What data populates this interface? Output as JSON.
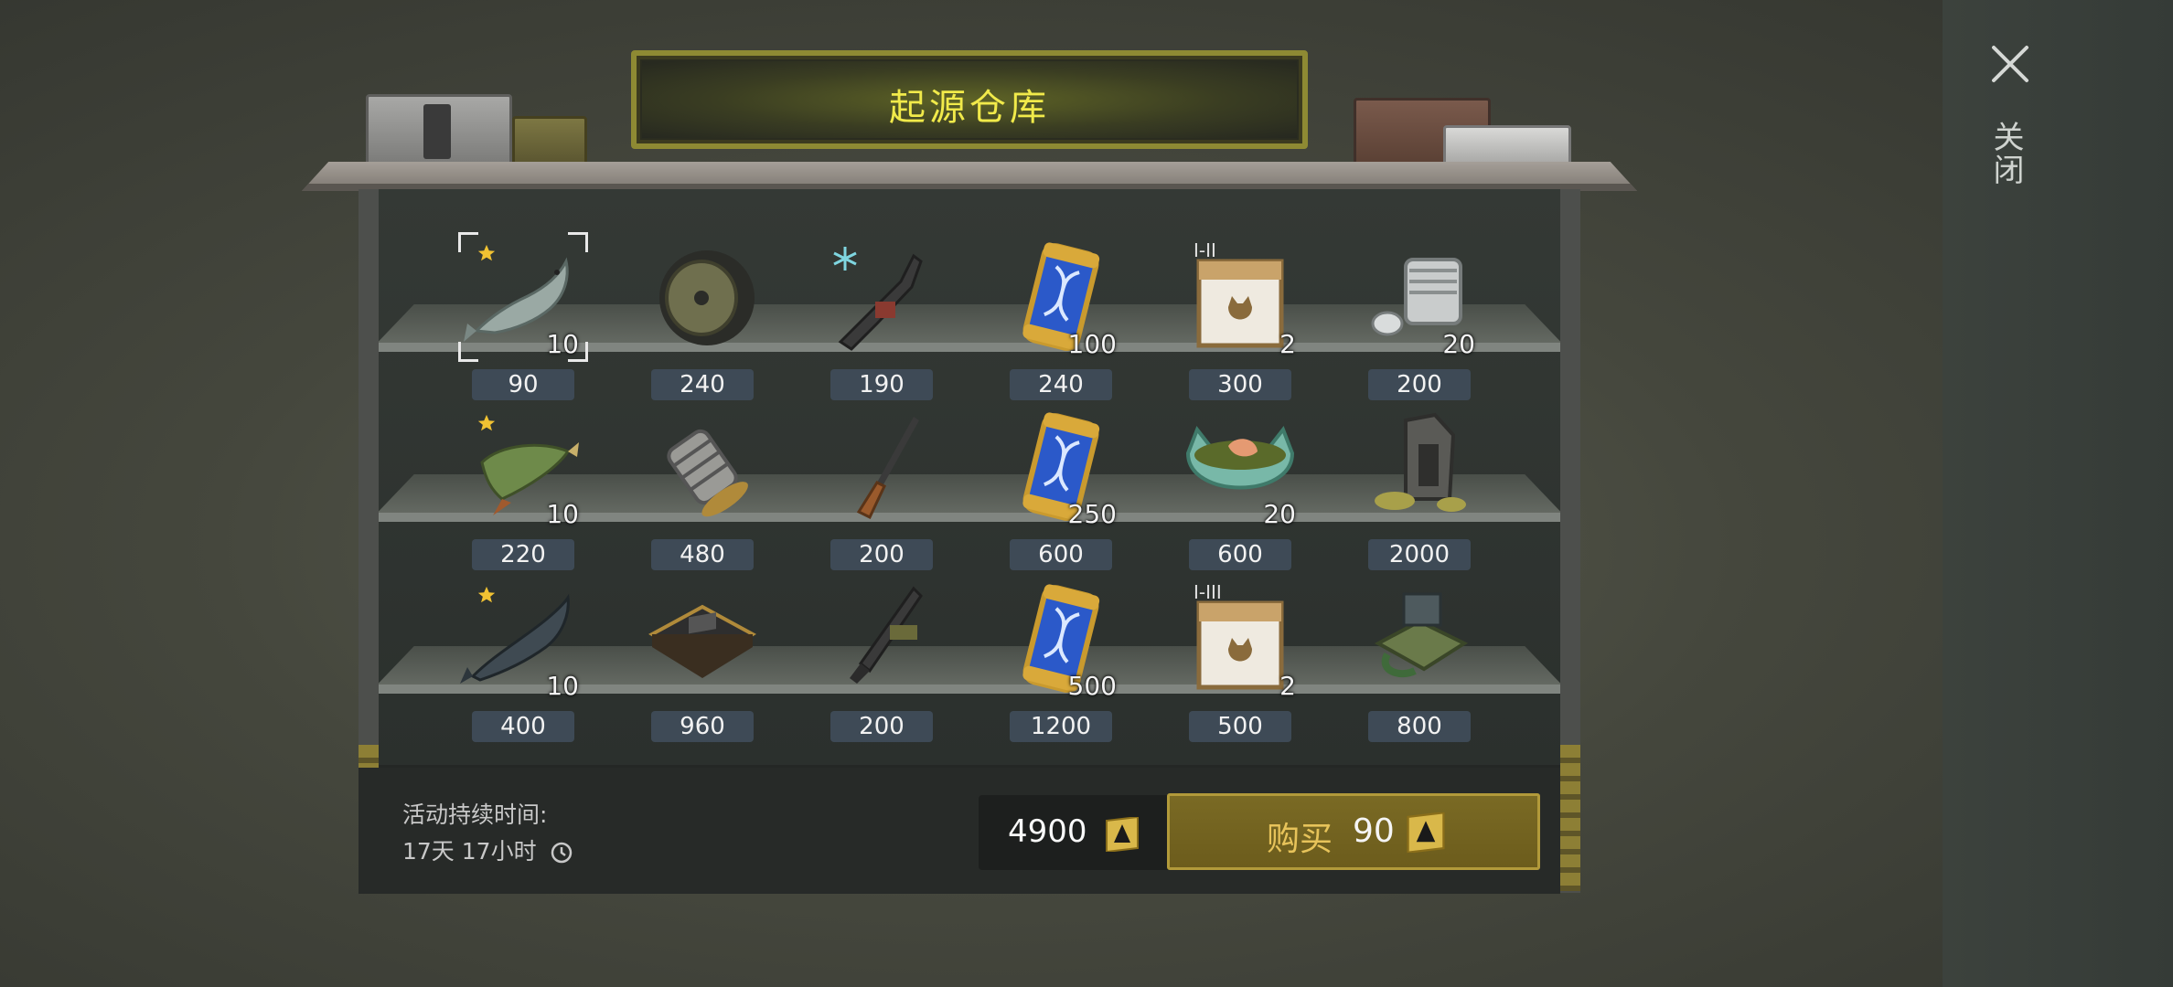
{
  "title": "起源仓库",
  "close": {
    "label": "关闭"
  },
  "items": [
    {
      "price": "90",
      "qty": "10",
      "star": true
    },
    {
      "price": "240",
      "qty": ""
    },
    {
      "price": "190",
      "qty": ""
    },
    {
      "price": "240",
      "qty": "100"
    },
    {
      "price": "300",
      "qty": "2",
      "tier": "I-II"
    },
    {
      "price": "200",
      "qty": "20"
    },
    {
      "price": "220",
      "qty": "10",
      "star": true
    },
    {
      "price": "480",
      "qty": ""
    },
    {
      "price": "200",
      "qty": ""
    },
    {
      "price": "600",
      "qty": "250"
    },
    {
      "price": "600",
      "qty": "20"
    },
    {
      "price": "2000",
      "qty": ""
    },
    {
      "price": "400",
      "qty": "10",
      "star": true
    },
    {
      "price": "960",
      "qty": ""
    },
    {
      "price": "200",
      "qty": ""
    },
    {
      "price": "1200",
      "qty": "500"
    },
    {
      "price": "500",
      "qty": "2",
      "tier": "I-III"
    },
    {
      "price": "800",
      "qty": ""
    }
  ],
  "event": {
    "duration_label": "活动持续时间:",
    "duration_value": "17天 17小时"
  },
  "balance": {
    "amount": "4900"
  },
  "buy": {
    "label": "购买",
    "price": "90"
  },
  "colors": {
    "title_text": "#f1ea4a",
    "buy_button": "#6c5c1c",
    "price_tag": "#3e4a56"
  }
}
